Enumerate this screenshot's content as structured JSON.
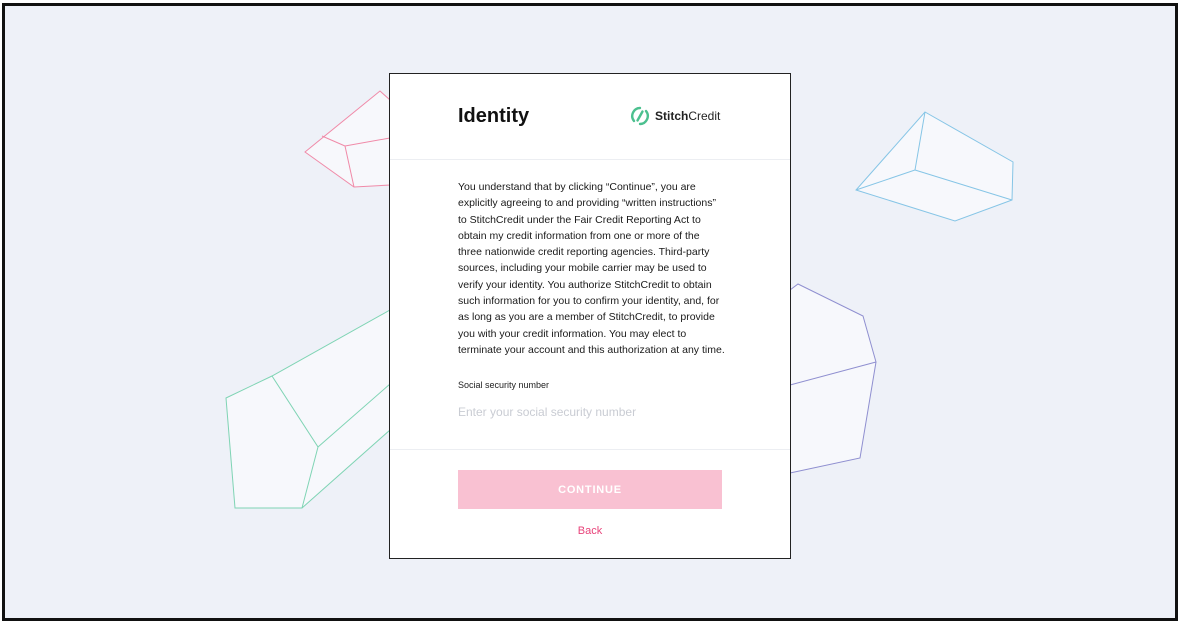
{
  "card": {
    "title": "Identity",
    "logo": {
      "name_bold": "Stitch",
      "name_light": "Credit",
      "icon": "stitchcredit-logo-icon"
    },
    "consent_text": "You understand that by clicking “Continue”, you are explicitly agreeing to and providing “written instructions” to StitchCredit under the Fair Credit Reporting Act to obtain my credit information from one or more of the three nationwide credit reporting agencies. Third-party sources, including your mobile carrier may be used to verify your identity. You authorize StitchCredit to obtain such information for you to confirm your identity, and, for as long as you are a member of StitchCredit, to provide you with your credit information. You may elect to terminate your account and this authorization at any time.",
    "ssn_label": "Social security number",
    "ssn_placeholder": "Enter your social security number",
    "ssn_value": "",
    "continue_label": "CONTINUE",
    "back_label": "Back"
  },
  "colors": {
    "accent": "#e8437a",
    "button_disabled": "#f9c1d2",
    "logo_green": "#4cc08f",
    "background": "#eef1f8"
  }
}
